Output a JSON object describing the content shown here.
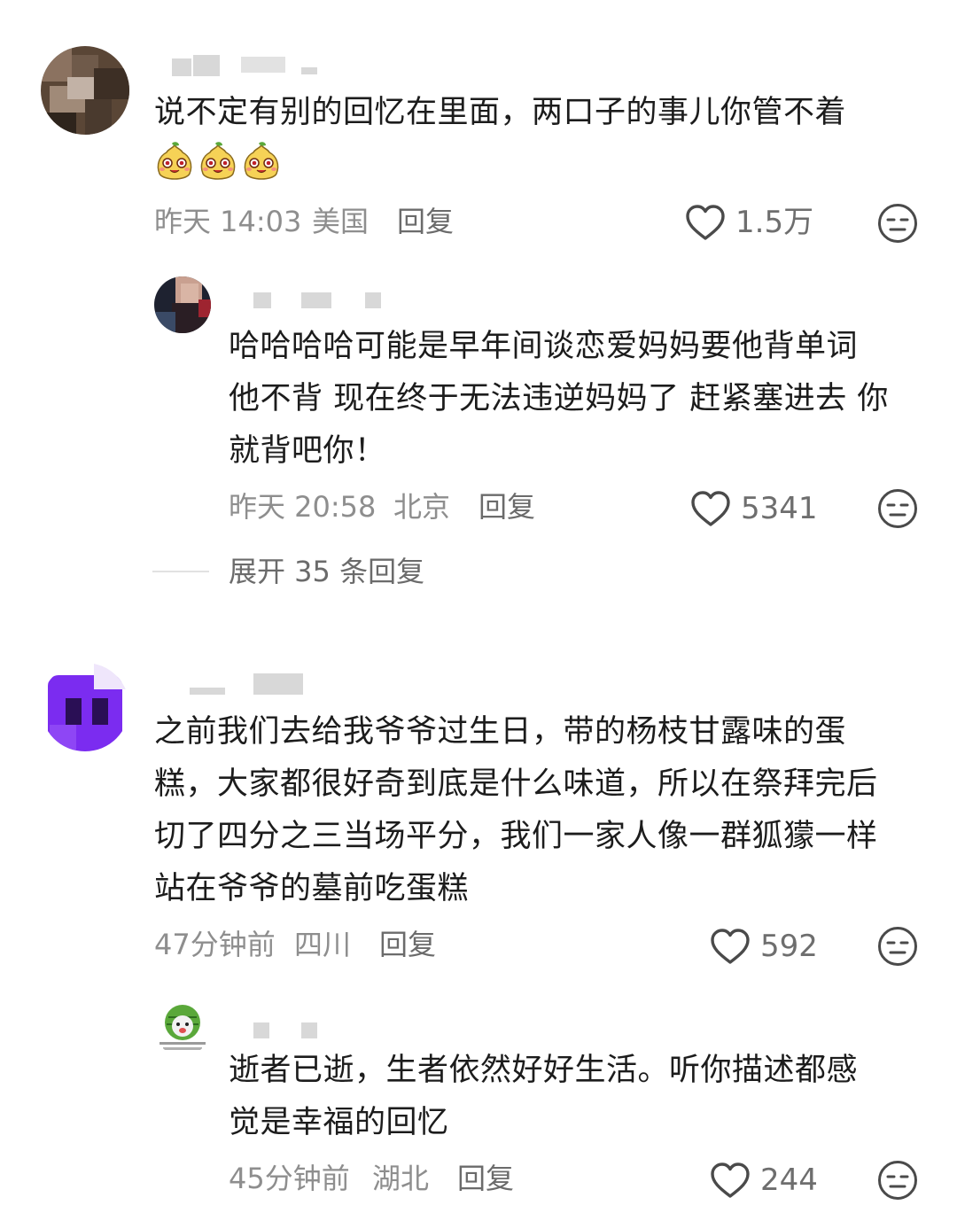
{
  "comments": [
    {
      "text_lines": [
        "说不定有别的回忆在里面，两口子的事儿你管不着"
      ],
      "emoji_count": 3,
      "time": "昨天 14:03",
      "location": "美国",
      "reply_label": "回复",
      "likes": "1.5万",
      "replies": [
        {
          "text_lines": [
            "哈哈哈哈可能是早年间谈恋爱妈妈要他背单词",
            "他不背 现在终于无法违逆妈妈了 赶紧塞进去 你",
            "就背吧你！"
          ],
          "time": "昨天 20:58",
          "location": "北京",
          "reply_label": "回复",
          "likes": "5341"
        }
      ],
      "expand_label": "展开 35 条回复"
    },
    {
      "text_lines": [
        "之前我们去给我爷爷过生日，带的杨枝甘露味的蛋",
        "糕，大家都很好奇到底是什么味道，所以在祭拜完后",
        "切了四分之三当场平分，我们一家人像一群狐獴一样",
        "站在爷爷的墓前吃蛋糕"
      ],
      "time": "47分钟前",
      "location": "四川",
      "reply_label": "回复",
      "likes": "592",
      "replies": [
        {
          "text_lines": [
            "逝者已逝，生者依然好好生活。听你描述都感",
            "觉是幸福的回忆"
          ],
          "time": "45分钟前",
          "location": "湖北",
          "reply_label": "回复",
          "likes": "244"
        }
      ]
    }
  ],
  "icons": {
    "like": "heart-outline-icon",
    "dislike": "neutral-face-icon",
    "emoji": "smiling-pear-emoji-icon"
  },
  "colors": {
    "text": "#1c1c1c",
    "meta": "#8e8e8e",
    "action": "#6b6b6b",
    "icon": "#4a4a4a",
    "avatar3": "#7b2cf0"
  }
}
